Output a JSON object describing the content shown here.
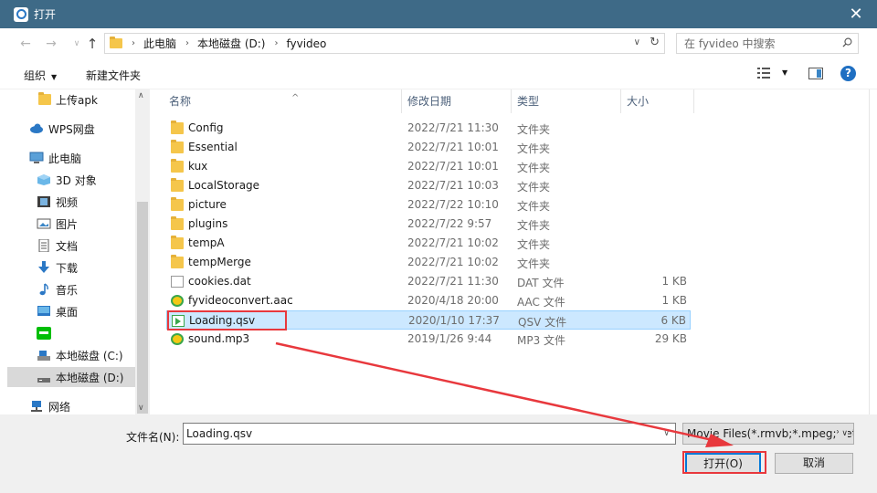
{
  "window": {
    "title": "打开",
    "app_icon": "camera-app-icon",
    "close_glyph": "✕"
  },
  "address": {
    "crumbs": [
      "此电脑",
      "本地磁盘 (D:)",
      "fyvideo"
    ],
    "separator": "›",
    "search_placeholder": "在 fyvideo 中搜索"
  },
  "toolbar": {
    "organize": "组织",
    "new_folder": "新建文件夹",
    "help": "?"
  },
  "sidebar": {
    "items": [
      {
        "label": "上传apk",
        "icon": "folder-icon"
      },
      {
        "label": "WPS网盘",
        "icon": "cloud-icon"
      },
      {
        "label": "此电脑",
        "icon": "computer-icon"
      },
      {
        "label": "3D 对象",
        "icon": "3d-objects-icon"
      },
      {
        "label": "视频",
        "icon": "video-icon"
      },
      {
        "label": "图片",
        "icon": "pictures-icon"
      },
      {
        "label": "文档",
        "icon": "documents-icon"
      },
      {
        "label": "下载",
        "icon": "download-icon"
      },
      {
        "label": "音乐",
        "icon": "music-icon"
      },
      {
        "label": "桌面",
        "icon": "desktop-icon"
      },
      {
        "label": "",
        "icon": "iqiyi-icon"
      },
      {
        "label": "本地磁盘 (C:)",
        "icon": "drive-icon"
      },
      {
        "label": "本地磁盘 (D:)",
        "icon": "drive-icon"
      },
      {
        "label": "网络",
        "icon": "network-icon"
      }
    ]
  },
  "columns": {
    "name": "名称",
    "modified": "修改日期",
    "type": "类型",
    "size": "大小"
  },
  "files": [
    {
      "name": "Config",
      "date": "2022/7/21 11:30",
      "type": "文件夹",
      "size": "",
      "icon": "folder-icon"
    },
    {
      "name": "Essential",
      "date": "2022/7/21 10:01",
      "type": "文件夹",
      "size": "",
      "icon": "folder-icon"
    },
    {
      "name": "kux",
      "date": "2022/7/21 10:01",
      "type": "文件夹",
      "size": "",
      "icon": "folder-icon"
    },
    {
      "name": "LocalStorage",
      "date": "2022/7/21 10:03",
      "type": "文件夹",
      "size": "",
      "icon": "folder-icon"
    },
    {
      "name": "picture",
      "date": "2022/7/22 10:10",
      "type": "文件夹",
      "size": "",
      "icon": "folder-icon"
    },
    {
      "name": "plugins",
      "date": "2022/7/22 9:57",
      "type": "文件夹",
      "size": "",
      "icon": "folder-icon"
    },
    {
      "name": "tempA",
      "date": "2022/7/21 10:02",
      "type": "文件夹",
      "size": "",
      "icon": "folder-icon"
    },
    {
      "name": "tempMerge",
      "date": "2022/7/21 10:02",
      "type": "文件夹",
      "size": "",
      "icon": "folder-icon"
    },
    {
      "name": "cookies.dat",
      "date": "2022/7/21 11:30",
      "type": "DAT 文件",
      "size": "1 KB",
      "icon": "file-icon"
    },
    {
      "name": "fyvideoconvert.aac",
      "date": "2020/4/18 20:00",
      "type": "AAC 文件",
      "size": "1 KB",
      "icon": "audio-icon"
    },
    {
      "name": "Loading.qsv",
      "date": "2020/1/10 17:37",
      "type": "QSV 文件",
      "size": "6 KB",
      "icon": "video-file-icon"
    },
    {
      "name": "sound.mp3",
      "date": "2019/1/26 9:44",
      "type": "MP3 文件",
      "size": "29 KB",
      "icon": "audio-icon"
    }
  ],
  "bottom": {
    "filename_label": "文件名(N):",
    "filename_value": "Loading.qsv",
    "filter_value": "Movie Files(*.rmvb;*.mpeg;*.et",
    "open_label": "打开(O)",
    "cancel_label": "取消"
  },
  "colors": {
    "titlebar": "#3e6a87",
    "selection": "#cce8ff",
    "annotation": "#e8383d",
    "accent": "#0078d7"
  }
}
